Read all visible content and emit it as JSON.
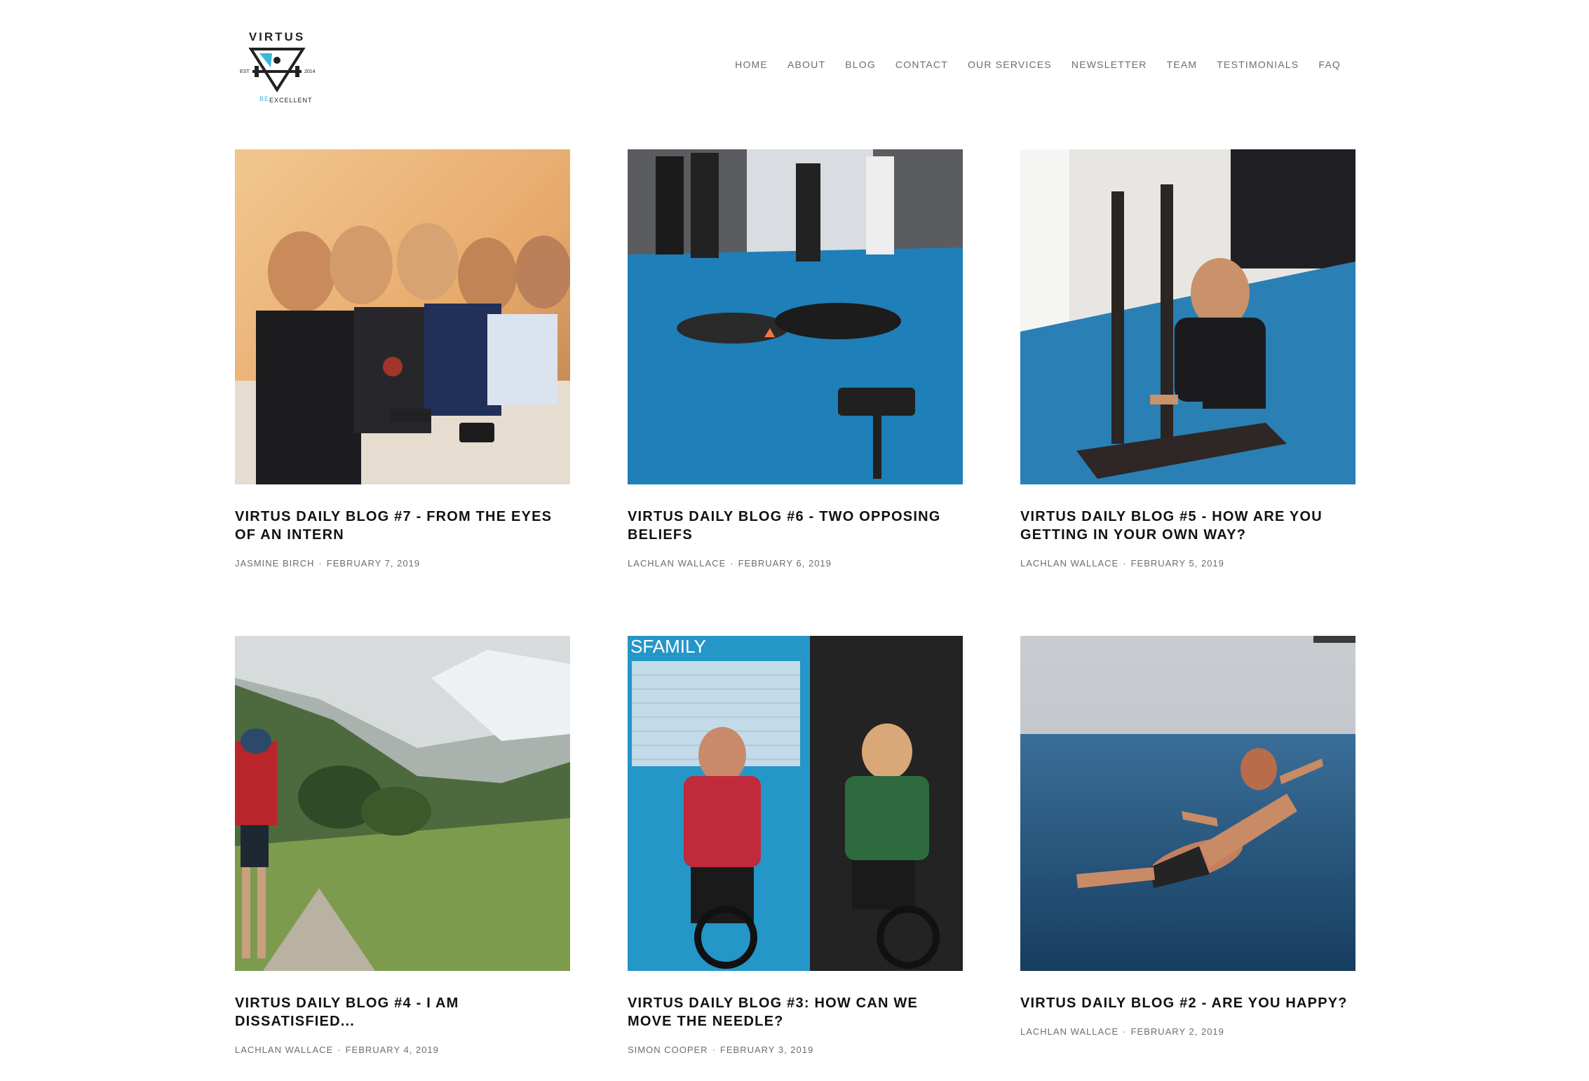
{
  "brand": {
    "logo_word": "VIRTUS",
    "logo_est": "EST",
    "logo_year": "2014",
    "logo_tag_be": "BE",
    "logo_tag_rest": "EXCELLENT"
  },
  "nav": [
    {
      "label": "HOME"
    },
    {
      "label": "ABOUT"
    },
    {
      "label": "BLOG"
    },
    {
      "label": "CONTACT"
    },
    {
      "label": "OUR SERVICES"
    },
    {
      "label": "NEWSLETTER"
    },
    {
      "label": "TEAM"
    },
    {
      "label": "TESTIMONIALS"
    },
    {
      "label": "FAQ"
    }
  ],
  "posts": [
    {
      "title": "VIRTUS DAILY BLOG #7 - FROM THE EYES OF AN INTERN",
      "author": "JASMINE BIRCH",
      "date": "FEBRUARY 7, 2019",
      "image": "group-of-friends-at-cafe"
    },
    {
      "title": "VIRTUS DAILY BLOG #6 - TWO OPPOSING BELIEFS",
      "author": "LACHLAN WALLACE",
      "date": "FEBRUARY 6, 2019",
      "image": "gym-partner-pushups"
    },
    {
      "title": "VIRTUS DAILY BLOG #5 - HOW ARE YOU GETTING IN YOUR OWN WAY?",
      "author": "LACHLAN WALLACE",
      "date": "FEBRUARY 5, 2019",
      "image": "man-with-sled-in-gym"
    },
    {
      "title": "VIRTUS DAILY BLOG #4 - I AM DISSATISFIED...",
      "author": "LACHLAN WALLACE",
      "date": "FEBRUARY 4, 2019",
      "image": "hiker-in-mountain-valley"
    },
    {
      "title": "VIRTUS DAILY BLOG #3: HOW CAN WE MOVE THE NEEDLE?",
      "author": "SIMON COOPER",
      "date": "FEBRUARY 3, 2019",
      "image": "two-men-on-air-bikes",
      "wall_text": "SFAMILY"
    },
    {
      "title": "VIRTUS DAILY BLOG #2 - ARE YOU HAPPY?",
      "author": "LACHLAN WALLACE",
      "date": "FEBRUARY 2, 2019",
      "image": "man-leaping-over-sea"
    }
  ],
  "meta_separator": "·",
  "colors": {
    "accent": "#3cb6d6",
    "nav_text": "#6d6d6d",
    "title_text": "#111111"
  }
}
